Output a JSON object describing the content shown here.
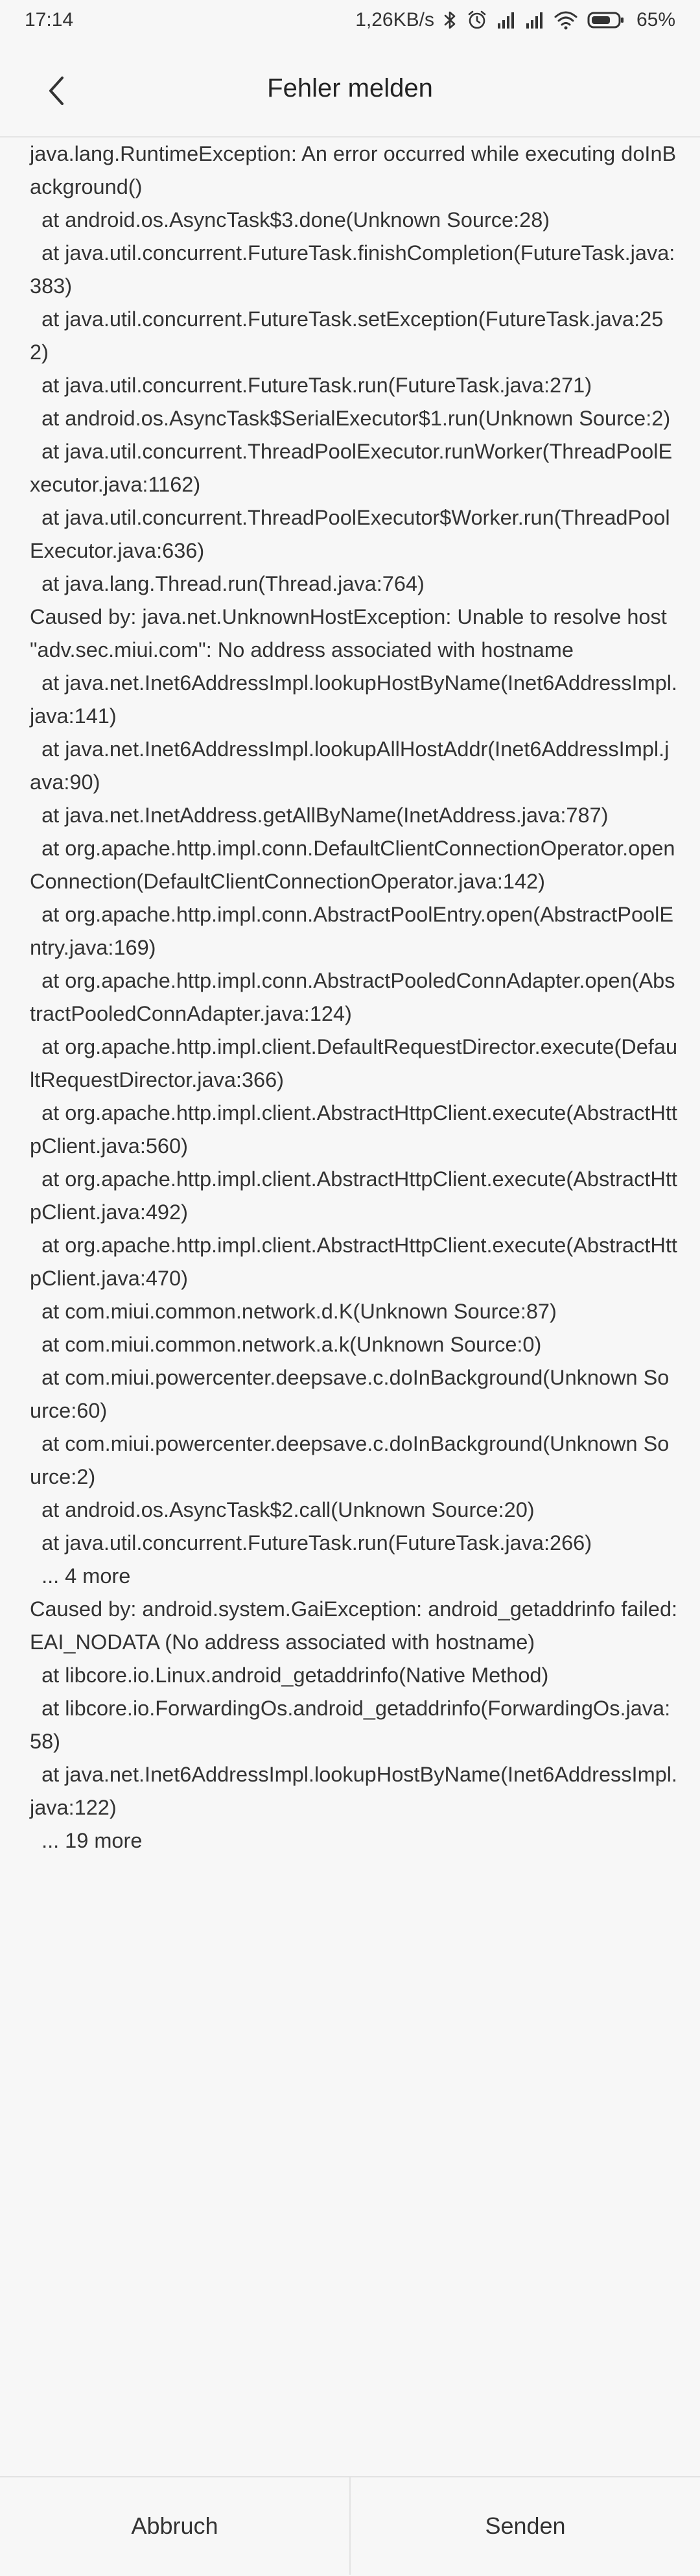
{
  "status_bar": {
    "time": "17:14",
    "network_speed": "1,26KB/s",
    "battery": "65%"
  },
  "header": {
    "title": "Fehler melden",
    "back_icon": "chevron-left-icon"
  },
  "log": {
    "lines": [
      "java.lang.RuntimeException: An error occurred while executing doInBackground()",
      "  at android.os.AsyncTask$3.done(Unknown Source:28)",
      "  at java.util.concurrent.FutureTask.finishCompletion(FutureTask.java:383)",
      "  at java.util.concurrent.FutureTask.setException(FutureTask.java:252)",
      "  at java.util.concurrent.FutureTask.run(FutureTask.java:271)",
      "  at android.os.AsyncTask$SerialExecutor$1.run(Unknown Source:2)",
      "  at java.util.concurrent.ThreadPoolExecutor.runWorker(ThreadPoolExecutor.java:1162)",
      "  at java.util.concurrent.ThreadPoolExecutor$Worker.run(ThreadPoolExecutor.java:636)",
      "  at java.lang.Thread.run(Thread.java:764)",
      "Caused by: java.net.UnknownHostException: Unable to resolve host \"adv.sec.miui.com\": No address associated with hostname",
      "  at java.net.Inet6AddressImpl.lookupHostByName(Inet6AddressImpl.java:141)",
      "  at java.net.Inet6AddressImpl.lookupAllHostAddr(Inet6AddressImpl.java:90)",
      "  at java.net.InetAddress.getAllByName(InetAddress.java:787)",
      "  at org.apache.http.impl.conn.DefaultClientConnectionOperator.openConnection(DefaultClientConnectionOperator.java:142)",
      "  at org.apache.http.impl.conn.AbstractPoolEntry.open(AbstractPoolEntry.java:169)",
      "  at org.apache.http.impl.conn.AbstractPooledConnAdapter.open(AbstractPooledConnAdapter.java:124)",
      "  at org.apache.http.impl.client.DefaultRequestDirector.execute(DefaultRequestDirector.java:366)",
      "  at org.apache.http.impl.client.AbstractHttpClient.execute(AbstractHttpClient.java:560)",
      "  at org.apache.http.impl.client.AbstractHttpClient.execute(AbstractHttpClient.java:492)",
      "  at org.apache.http.impl.client.AbstractHttpClient.execute(AbstractHttpClient.java:470)",
      "  at com.miui.common.network.d.K(Unknown Source:87)",
      "  at com.miui.common.network.a.k(Unknown Source:0)",
      "  at com.miui.powercenter.deepsave.c.doInBackground(Unknown Source:60)",
      "  at com.miui.powercenter.deepsave.c.doInBackground(Unknown Source:2)",
      "  at android.os.AsyncTask$2.call(Unknown Source:20)",
      "  at java.util.concurrent.FutureTask.run(FutureTask.java:266)",
      "  ... 4 more",
      "Caused by: android.system.GaiException: android_getaddrinfo failed: EAI_NODATA (No address associated with hostname)",
      "  at libcore.io.Linux.android_getaddrinfo(Native Method)",
      "  at libcore.io.ForwardingOs.android_getaddrinfo(ForwardingOs.java:58)",
      "  at java.net.Inet6AddressImpl.lookupHostByName(Inet6AddressImpl.java:122)",
      "  ... 19 more"
    ]
  },
  "footer": {
    "cancel_label": "Abbruch",
    "send_label": "Senden"
  }
}
